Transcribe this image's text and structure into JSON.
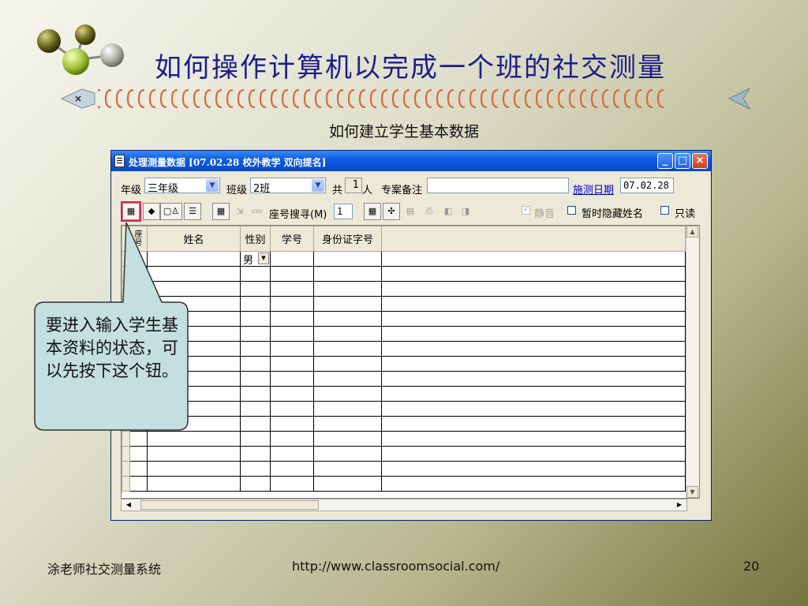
{
  "slide": {
    "title": "如何操作计算机以完成一个班的社交测量",
    "subtitle": "如何建立学生基本数据",
    "callout": "要进入输入学生基本资料的状态，可以先按下这个钮。",
    "footer_left": "涂老师社交测量系统",
    "footer_center": "http://www.classroomsocial.com/",
    "page_number": "20"
  },
  "window": {
    "title": "处理测量数据 [07.02.28  校外教学  双向提名]",
    "controls": {
      "minimize": "_",
      "maximize": "□",
      "close": "×"
    }
  },
  "form": {
    "grade_label": "年级",
    "grade_value": "三年级",
    "class_label": "班级",
    "class_value": "2班",
    "total_prefix": "共",
    "total_count": "1",
    "total_suffix": "人",
    "note_label": "专案备注",
    "note_value": "",
    "date_link": "施测日期",
    "date_value": "07.02.28"
  },
  "toolbar": {
    "seat_search_label": "座号搜寻(M)",
    "seat_search_value": "1",
    "csv_label": "csv",
    "mute_label": "静音",
    "hide_names_label": "暂时隐藏姓名",
    "readonly_label": "只读"
  },
  "grid": {
    "columns": [
      "座号",
      "姓名",
      "性别",
      "学号",
      "身份证字号"
    ],
    "first_row_gender": "男"
  },
  "colors": {
    "title_text": "#1d1d8a",
    "titlebar": "#0a52d6",
    "highlight_border": "#e0245e",
    "callout_fill": "#c5dfe0"
  }
}
